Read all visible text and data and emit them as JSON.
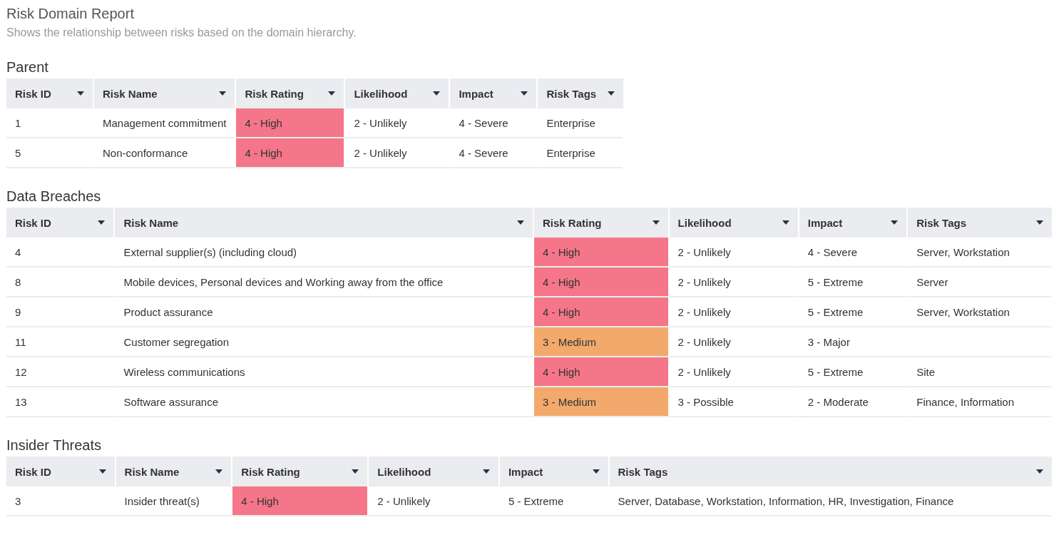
{
  "title": "Risk Domain Report",
  "subtitle": "Shows the relationship between risks based on the domain hierarchy.",
  "sections": [
    {
      "title": "Parent",
      "columns": [
        "Risk ID",
        "Risk Name",
        "Risk Rating",
        "Likelihood",
        "Impact",
        "Risk Tags"
      ],
      "rows": [
        {
          "id": "1",
          "name": "Management commitment",
          "rating": "4 - High",
          "color": "#f47688",
          "likelihood": "2 - Unlikely",
          "impact": "4 - Severe",
          "tags": "Enterprise"
        },
        {
          "id": "5",
          "name": "Non-conformance",
          "rating": "4 - High",
          "color": "#f47688",
          "likelihood": "2 - Unlikely",
          "impact": "4 - Severe",
          "tags": "Enterprise"
        }
      ]
    },
    {
      "title": "Data Breaches",
      "columns": [
        "Risk ID",
        "Risk Name",
        "Risk Rating",
        "Likelihood",
        "Impact",
        "Risk Tags"
      ],
      "rows": [
        {
          "id": "4",
          "name": "External supplier(s) (including cloud)",
          "rating": "4 - High",
          "color": "#f47688",
          "likelihood": "2 - Unlikely",
          "impact": "4 - Severe",
          "tags": "Server, Workstation"
        },
        {
          "id": "8",
          "name": "Mobile devices, Personal devices and Working away from the office",
          "rating": "4 - High",
          "color": "#f47688",
          "likelihood": "2 - Unlikely",
          "impact": "5 - Extreme",
          "tags": "Server"
        },
        {
          "id": "9",
          "name": "Product assurance",
          "rating": "4 - High",
          "color": "#f47688",
          "likelihood": "2 - Unlikely",
          "impact": "5 - Extreme",
          "tags": "Server, Workstation"
        },
        {
          "id": "11",
          "name": "Customer segregation",
          "rating": "3 - Medium",
          "color": "#f2a96b",
          "likelihood": "2 - Unlikely",
          "impact": "3 - Major"
        },
        {
          "id": "12",
          "name": "Wireless communications",
          "rating": "4 - High",
          "color": "#f47688",
          "likelihood": "2 - Unlikely",
          "impact": "5 - Extreme",
          "tags": "Site"
        },
        {
          "id": "13",
          "name": "Software assurance",
          "rating": "3 - Medium",
          "color": "#f2a96b",
          "likelihood": "3 - Possible",
          "impact": "2 - Moderate",
          "tags": "Finance, Information"
        }
      ]
    },
    {
      "title": "Insider Threats",
      "columns": [
        "Risk ID",
        "Risk Name",
        "Risk Rating",
        "Likelihood",
        "Impact",
        "Risk Tags"
      ],
      "rows": [
        {
          "id": "3",
          "name": "Insider threat(s)",
          "rating": "4 - High",
          "color": "#f47688",
          "likelihood": "2 - Unlikely",
          "impact": "5 - Extreme",
          "tags": "Server, Database, Workstation, Information, HR, Investigation, Finance"
        }
      ]
    }
  ]
}
